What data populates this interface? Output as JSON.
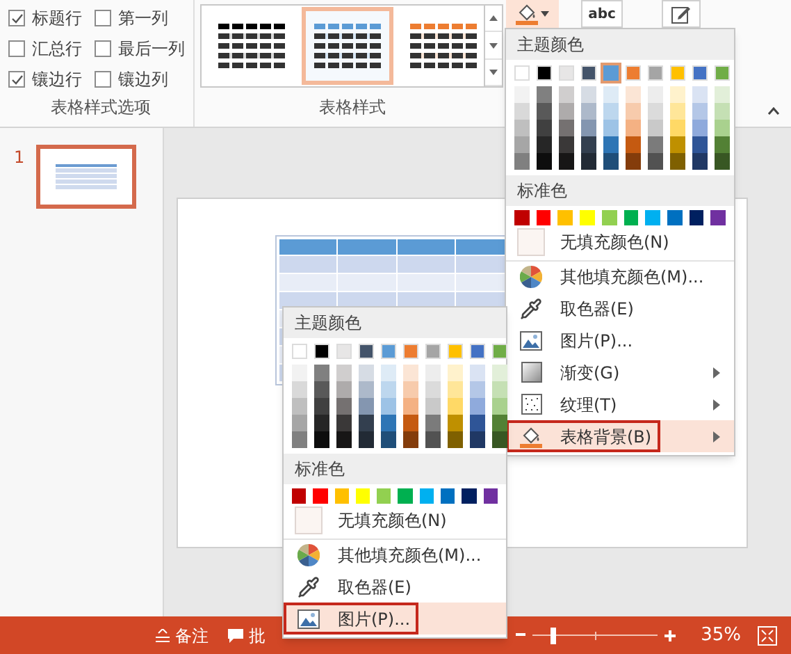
{
  "ribbon": {
    "style_options": {
      "checkboxes": [
        {
          "label": "标题行",
          "checked": true
        },
        {
          "label": "第一列",
          "checked": false
        },
        {
          "label": "汇总行",
          "checked": false
        },
        {
          "label": "最后一列",
          "checked": false
        },
        {
          "label": "镶边行",
          "checked": true
        },
        {
          "label": "镶边列",
          "checked": false
        }
      ],
      "group_label": "表格样式选项"
    },
    "table_styles": {
      "styles": [
        {
          "color": "#000000",
          "selected": false
        },
        {
          "color": "#5b9bd5",
          "selected": true
        },
        {
          "color": "#ed7d31",
          "selected": false
        }
      ],
      "group_label": "表格样式"
    },
    "tools": [
      {
        "kind": "shading",
        "pressed": true
      },
      {
        "kind": "text-effects",
        "label": "abc",
        "pressed": false
      },
      {
        "kind": "edit",
        "pressed": false
      }
    ]
  },
  "thumbnails": [
    {
      "number": "1",
      "selected": true
    }
  ],
  "shading_menu": {
    "theme_header": "主题颜色",
    "theme_colors": [
      {
        "color": "#ffffff",
        "selected": false,
        "shades": [
          {
            "color": "#f2f2f2"
          },
          {
            "color": "#d9d9d9"
          },
          {
            "color": "#bfbfbf"
          },
          {
            "color": "#a6a6a6"
          },
          {
            "color": "#808080"
          }
        ]
      },
      {
        "color": "#000000",
        "selected": false,
        "shades": [
          {
            "color": "#808080"
          },
          {
            "color": "#595959"
          },
          {
            "color": "#404040"
          },
          {
            "color": "#262626"
          },
          {
            "color": "#0d0d0d"
          }
        ]
      },
      {
        "color": "#e7e6e6",
        "selected": false,
        "shades": [
          {
            "color": "#d0cece"
          },
          {
            "color": "#aeabab"
          },
          {
            "color": "#757171"
          },
          {
            "color": "#3a3838"
          },
          {
            "color": "#171616"
          }
        ]
      },
      {
        "color": "#44546a",
        "selected": false,
        "shades": [
          {
            "color": "#d6dce4"
          },
          {
            "color": "#adb9ca"
          },
          {
            "color": "#8496b0"
          },
          {
            "color": "#333f4f"
          },
          {
            "color": "#222a35"
          }
        ]
      },
      {
        "color": "#5b9bd5",
        "selected": true,
        "shades": [
          {
            "color": "#deebf6"
          },
          {
            "color": "#bdd7ee"
          },
          {
            "color": "#9dc3e6"
          },
          {
            "color": "#2e75b5"
          },
          {
            "color": "#1f4e79"
          }
        ]
      },
      {
        "color": "#ed7d31",
        "selected": false,
        "shades": [
          {
            "color": "#fbe5d5"
          },
          {
            "color": "#f7cbac"
          },
          {
            "color": "#f4b183"
          },
          {
            "color": "#c55a11"
          },
          {
            "color": "#843c0b"
          }
        ]
      },
      {
        "color": "#a5a5a5",
        "selected": false,
        "shades": [
          {
            "color": "#ededed"
          },
          {
            "color": "#dbdbdb"
          },
          {
            "color": "#c9c9c9"
          },
          {
            "color": "#7b7b7b"
          },
          {
            "color": "#525252"
          }
        ]
      },
      {
        "color": "#ffc000",
        "selected": false,
        "shades": [
          {
            "color": "#fff2cc"
          },
          {
            "color": "#ffe699"
          },
          {
            "color": "#ffd966"
          },
          {
            "color": "#bf9000"
          },
          {
            "color": "#7f6000"
          }
        ]
      },
      {
        "color": "#4472c4",
        "selected": false,
        "shades": [
          {
            "color": "#dae3f3"
          },
          {
            "color": "#b4c7e7"
          },
          {
            "color": "#8faadc"
          },
          {
            "color": "#2f5597"
          },
          {
            "color": "#203864"
          }
        ]
      },
      {
        "color": "#70ad47",
        "selected": false,
        "shades": [
          {
            "color": "#e2efd9"
          },
          {
            "color": "#c5e0b4"
          },
          {
            "color": "#a9d18e"
          },
          {
            "color": "#538135"
          },
          {
            "color": "#385723"
          }
        ]
      }
    ],
    "standard_header": "标准色",
    "standard_colors": [
      {
        "color": "#c00000"
      },
      {
        "color": "#ff0000"
      },
      {
        "color": "#ffc000"
      },
      {
        "color": "#ffff00"
      },
      {
        "color": "#92d050"
      },
      {
        "color": "#00b050"
      },
      {
        "color": "#00b0f0"
      },
      {
        "color": "#0070c0"
      },
      {
        "color": "#002060"
      },
      {
        "color": "#7030a0"
      }
    ],
    "items": [
      {
        "kind": "no-fill",
        "label": "无填充颜色(N)",
        "submenu": false,
        "selected": false
      },
      {
        "kind": "more-colors",
        "label": "其他填充颜色(M)...",
        "submenu": false,
        "selected": false
      },
      {
        "kind": "eyedropper",
        "label": "取色器(E)",
        "submenu": false,
        "selected": false
      },
      {
        "kind": "picture",
        "label": "图片(P)...",
        "submenu": false,
        "selected": false
      },
      {
        "kind": "gradient",
        "label": "渐变(G)",
        "submenu": true,
        "selected": false
      },
      {
        "kind": "texture",
        "label": "纹理(T)",
        "submenu": true,
        "selected": false
      },
      {
        "kind": "table-background",
        "label": "表格背景(B)",
        "submenu": true,
        "selected": true
      }
    ]
  },
  "background_menu": {
    "theme_header": "主题颜色",
    "theme_colors": [
      {
        "color": "#ffffff",
        "selected": false,
        "shades": [
          {
            "color": "#f2f2f2"
          },
          {
            "color": "#d9d9d9"
          },
          {
            "color": "#bfbfbf"
          },
          {
            "color": "#a6a6a6"
          },
          {
            "color": "#808080"
          }
        ]
      },
      {
        "color": "#000000",
        "selected": false,
        "shades": [
          {
            "color": "#808080"
          },
          {
            "color": "#595959"
          },
          {
            "color": "#404040"
          },
          {
            "color": "#262626"
          },
          {
            "color": "#0d0d0d"
          }
        ]
      },
      {
        "color": "#e7e6e6",
        "selected": false,
        "shades": [
          {
            "color": "#d0cece"
          },
          {
            "color": "#aeabab"
          },
          {
            "color": "#757171"
          },
          {
            "color": "#3a3838"
          },
          {
            "color": "#171616"
          }
        ]
      },
      {
        "color": "#44546a",
        "selected": false,
        "shades": [
          {
            "color": "#d6dce4"
          },
          {
            "color": "#adb9ca"
          },
          {
            "color": "#8496b0"
          },
          {
            "color": "#333f4f"
          },
          {
            "color": "#222a35"
          }
        ]
      },
      {
        "color": "#5b9bd5",
        "selected": false,
        "shades": [
          {
            "color": "#deebf6"
          },
          {
            "color": "#bdd7ee"
          },
          {
            "color": "#9dc3e6"
          },
          {
            "color": "#2e75b5"
          },
          {
            "color": "#1f4e79"
          }
        ]
      },
      {
        "color": "#ed7d31",
        "selected": false,
        "shades": [
          {
            "color": "#fbe5d5"
          },
          {
            "color": "#f7cbac"
          },
          {
            "color": "#f4b183"
          },
          {
            "color": "#c55a11"
          },
          {
            "color": "#843c0b"
          }
        ]
      },
      {
        "color": "#a5a5a5",
        "selected": false,
        "shades": [
          {
            "color": "#ededed"
          },
          {
            "color": "#dbdbdb"
          },
          {
            "color": "#c9c9c9"
          },
          {
            "color": "#7b7b7b"
          },
          {
            "color": "#525252"
          }
        ]
      },
      {
        "color": "#ffc000",
        "selected": false,
        "shades": [
          {
            "color": "#fff2cc"
          },
          {
            "color": "#ffe699"
          },
          {
            "color": "#ffd966"
          },
          {
            "color": "#bf9000"
          },
          {
            "color": "#7f6000"
          }
        ]
      },
      {
        "color": "#4472c4",
        "selected": false,
        "shades": [
          {
            "color": "#dae3f3"
          },
          {
            "color": "#b4c7e7"
          },
          {
            "color": "#8faadc"
          },
          {
            "color": "#2f5597"
          },
          {
            "color": "#203864"
          }
        ]
      },
      {
        "color": "#70ad47",
        "selected": false,
        "shades": [
          {
            "color": "#e2efd9"
          },
          {
            "color": "#c5e0b4"
          },
          {
            "color": "#a9d18e"
          },
          {
            "color": "#538135"
          },
          {
            "color": "#385723"
          }
        ]
      }
    ],
    "standard_header": "标准色",
    "standard_colors": [
      {
        "color": "#c00000"
      },
      {
        "color": "#ff0000"
      },
      {
        "color": "#ffc000"
      },
      {
        "color": "#ffff00"
      },
      {
        "color": "#92d050"
      },
      {
        "color": "#00b050"
      },
      {
        "color": "#00b0f0"
      },
      {
        "color": "#0070c0"
      },
      {
        "color": "#002060"
      },
      {
        "color": "#7030a0"
      }
    ],
    "items": [
      {
        "kind": "no-fill",
        "label": "无填充颜色(N)",
        "submenu": false,
        "selected": false
      },
      {
        "kind": "more-colors",
        "label": "其他填充颜色(M)...",
        "submenu": false,
        "selected": false
      },
      {
        "kind": "eyedropper",
        "label": "取色器(E)",
        "submenu": false,
        "selected": false
      },
      {
        "kind": "picture",
        "label": "图片(P)...",
        "submenu": false,
        "selected": true
      }
    ]
  },
  "status_bar": {
    "notes": "备注",
    "comments": "批",
    "zoom": {
      "level": 0.17,
      "reading": "35%"
    }
  }
}
